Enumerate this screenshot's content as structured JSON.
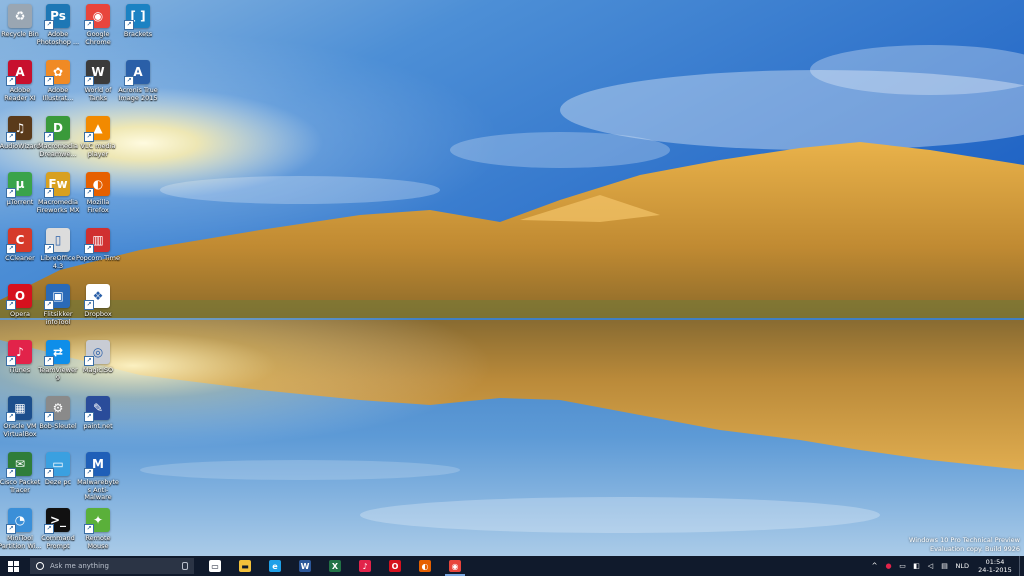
{
  "desktop": {
    "icons": [
      {
        "label": "Recycle Bin",
        "glyph": "♻",
        "color": "#9aa6b2",
        "icon": "recycle-bin-icon"
      },
      {
        "label": "Adobe Photoshop ...",
        "glyph": "Ps",
        "color": "#1e77b5",
        "icon": "photoshop-icon"
      },
      {
        "label": "Google Chrome",
        "glyph": "◉",
        "color": "#e8453c",
        "icon": "chrome-icon"
      },
      {
        "label": "Brackets",
        "glyph": "[ ]",
        "color": "#1b82c3",
        "icon": "brackets-icon"
      },
      {
        "label": "Adobe Reader XI",
        "glyph": "A",
        "color": "#c8102e",
        "icon": "adobe-reader-icon"
      },
      {
        "label": "Adobe Illustrat...",
        "glyph": "✿",
        "color": "#f08a24",
        "icon": "illustrator-icon"
      },
      {
        "label": "World of Tanks",
        "glyph": "W",
        "color": "#3b3b3b",
        "icon": "world-of-tanks-icon"
      },
      {
        "label": "Acronis True Image 2015",
        "glyph": "A",
        "color": "#2a5fa8",
        "icon": "acronis-icon"
      },
      {
        "label": "AudioWizard",
        "glyph": "♫",
        "color": "#5a3a1a",
        "icon": "audiowizard-icon"
      },
      {
        "label": "Macromedia Dreamwe...",
        "glyph": "D",
        "color": "#3a9a3a",
        "icon": "dreamweaver-icon"
      },
      {
        "label": "VLC media player",
        "glyph": "▲",
        "color": "#f28a00",
        "icon": "vlc-icon"
      },
      {
        "label": "µTorrent",
        "glyph": "µ",
        "color": "#3aa34a",
        "icon": "utorrent-icon"
      },
      {
        "label": "Macromedia Fireworks MX",
        "glyph": "Fw",
        "color": "#d8a020",
        "icon": "fireworks-icon"
      },
      {
        "label": "Mozilla Firefox",
        "glyph": "◐",
        "color": "#e66000",
        "icon": "firefox-icon"
      },
      {
        "label": "CCleaner",
        "glyph": "C",
        "color": "#d63a2a",
        "icon": "ccleaner-icon"
      },
      {
        "label": "LibreOffice 4.3",
        "glyph": "▯",
        "color": "#dcdcdc",
        "icon": "libreoffice-icon"
      },
      {
        "label": "Popcorn Time",
        "glyph": "▥",
        "color": "#d03030",
        "icon": "popcorn-time-icon"
      },
      {
        "label": "Opera",
        "glyph": "O",
        "color": "#d6111e",
        "icon": "opera-icon"
      },
      {
        "label": "Flitsikker infoTool",
        "glyph": "▣",
        "color": "#2a6ab8",
        "icon": "flitsikker-icon"
      },
      {
        "label": "Dropbox",
        "glyph": "❖",
        "color": "#ffffff",
        "icon": "dropbox-icon"
      },
      {
        "label": "iTunes",
        "glyph": "♪",
        "color": "#e2234a",
        "icon": "itunes-icon"
      },
      {
        "label": "TeamViewer 9",
        "glyph": "⇄",
        "color": "#0e8ee9",
        "icon": "teamviewer-icon"
      },
      {
        "label": "MagicISO",
        "glyph": "◎",
        "color": "#c8ccd4",
        "icon": "magiciso-icon"
      },
      {
        "label": "Oracle VM VirtualBox",
        "glyph": "▦",
        "color": "#1c4e8c",
        "icon": "virtualbox-icon"
      },
      {
        "label": "Bob-Sleutel",
        "glyph": "⚙",
        "color": "#8a8a8a",
        "icon": "bob-sleutel-icon"
      },
      {
        "label": "paint.net",
        "glyph": "✎",
        "color": "#2a4c9a",
        "icon": "paintnet-icon"
      },
      {
        "label": "Cisco Packet Tracer",
        "glyph": "✉",
        "color": "#2f7d3a",
        "icon": "packet-tracer-icon"
      },
      {
        "label": "Deze pc",
        "glyph": "▭",
        "color": "#3aa0e0",
        "icon": "this-pc-icon"
      },
      {
        "label": "Malwarebytes Anti-Malware",
        "glyph": "M",
        "color": "#1f5fb8",
        "icon": "malwarebytes-icon"
      },
      {
        "label": "MiniTool Partition Wi...",
        "glyph": "◔",
        "color": "#3a8fd8",
        "icon": "minitool-icon"
      },
      {
        "label": "Command Prompt",
        "glyph": ">_",
        "color": "#111111",
        "icon": "command-prompt-icon"
      },
      {
        "label": "Remote Mouse",
        "glyph": "✦",
        "color": "#5ab03a",
        "icon": "remote-mouse-icon"
      }
    ]
  },
  "watermark": {
    "line1": "Windows 10 Pro Technical Preview",
    "line2": "Evaluation copy. Build 9926"
  },
  "taskbar": {
    "search_placeholder": "Ask me anything",
    "apps": [
      {
        "name": "task-view",
        "glyph": "▭",
        "color": "#ffffff",
        "text": "#101a2c"
      },
      {
        "name": "file-explorer",
        "glyph": "▬",
        "color": "#f3c13a",
        "text": "#101a2c"
      },
      {
        "name": "internet-explorer",
        "glyph": "e",
        "color": "#1ea0e8",
        "text": "#ffffff"
      },
      {
        "name": "word",
        "glyph": "W",
        "color": "#2b579a",
        "text": "#ffffff"
      },
      {
        "name": "excel",
        "glyph": "X",
        "color": "#217346",
        "text": "#ffffff"
      },
      {
        "name": "itunes",
        "glyph": "♪",
        "color": "#e2234a",
        "text": "#ffffff"
      },
      {
        "name": "opera",
        "glyph": "O",
        "color": "#d6111e",
        "text": "#ffffff"
      },
      {
        "name": "firefox",
        "glyph": "◐",
        "color": "#e66000",
        "text": "#ffffff"
      },
      {
        "name": "chrome",
        "glyph": "◉",
        "color": "#e8453c",
        "text": "#ffffff"
      }
    ],
    "language": "NLD",
    "time": "01:54",
    "date": "24-1-2015"
  }
}
